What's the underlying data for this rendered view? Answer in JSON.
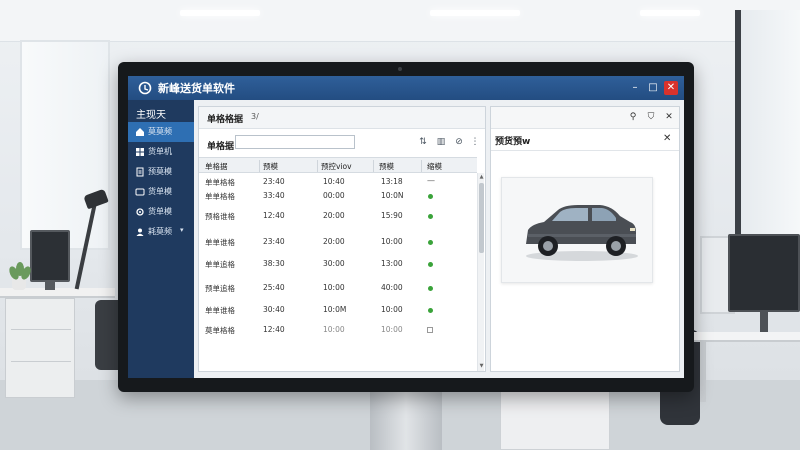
{
  "app": {
    "title": "新峰送货单软件",
    "window_controls": {
      "minimize": "–",
      "maximize": "□",
      "close": "✕"
    }
  },
  "sidebar": {
    "header": "主现天",
    "items": [
      {
        "label": "莫莫频",
        "icon": "home-icon",
        "active": true
      },
      {
        "label": "货单机",
        "icon": "grid-icon",
        "active": false
      },
      {
        "label": "预莫模",
        "icon": "document-icon",
        "active": false
      },
      {
        "label": "货单模",
        "icon": "list-icon",
        "active": false
      },
      {
        "label": "货单模",
        "icon": "settings-icon",
        "active": false
      },
      {
        "label": "耗莫频",
        "icon": "users-icon",
        "active": false,
        "has_chevron": true
      }
    ]
  },
  "main": {
    "title": "单格格据",
    "subtitle": "3/",
    "search_label": "单格据",
    "search_value": "",
    "tools": [
      "columns-icon",
      "layout-icon",
      "tag-icon",
      "more-icon"
    ],
    "columns": [
      "单格据",
      "预模",
      "预控viov",
      "预模",
      "缩模"
    ],
    "rows": [
      {
        "cells": [
          "单单格格",
          "23:40",
          "10:40",
          "13:18"
        ],
        "status": "dash",
        "status_text": "—"
      },
      {
        "cells": [
          "单单格格",
          "33:40",
          "00:00",
          "10:0N"
        ],
        "status": "dot"
      },
      {
        "cells": [
          "预格谁格",
          "12:40",
          "20:00",
          "15:90"
        ],
        "status": "dot"
      },
      {
        "cells": [
          "单单谁格",
          "23:40",
          "20:00",
          "10:00"
        ],
        "status": "dot"
      },
      {
        "cells": [
          "单单追格",
          "38:30",
          "30:00",
          "13:00"
        ],
        "status": "dot"
      },
      {
        "cells": [
          "预单追格",
          "25:40",
          "10:00",
          "40:00"
        ],
        "status": "dot"
      },
      {
        "cells": [
          "单单谁格",
          "30:40",
          "10:0M",
          "10:00"
        ],
        "status": "dot"
      },
      {
        "cells": [
          "莫单格格",
          "12:40",
          "10:00",
          "10:00"
        ],
        "status": "square"
      }
    ]
  },
  "preview": {
    "title": "预货預w",
    "tools": [
      "pin-icon",
      "bookmark-icon",
      "close-icon"
    ],
    "image": "car-image"
  },
  "colors": {
    "titlebar": "#2a5690",
    "sidebar": "#1f3a5f",
    "sidebar_active": "#2e6fb3",
    "status_green": "#3aa33a"
  }
}
